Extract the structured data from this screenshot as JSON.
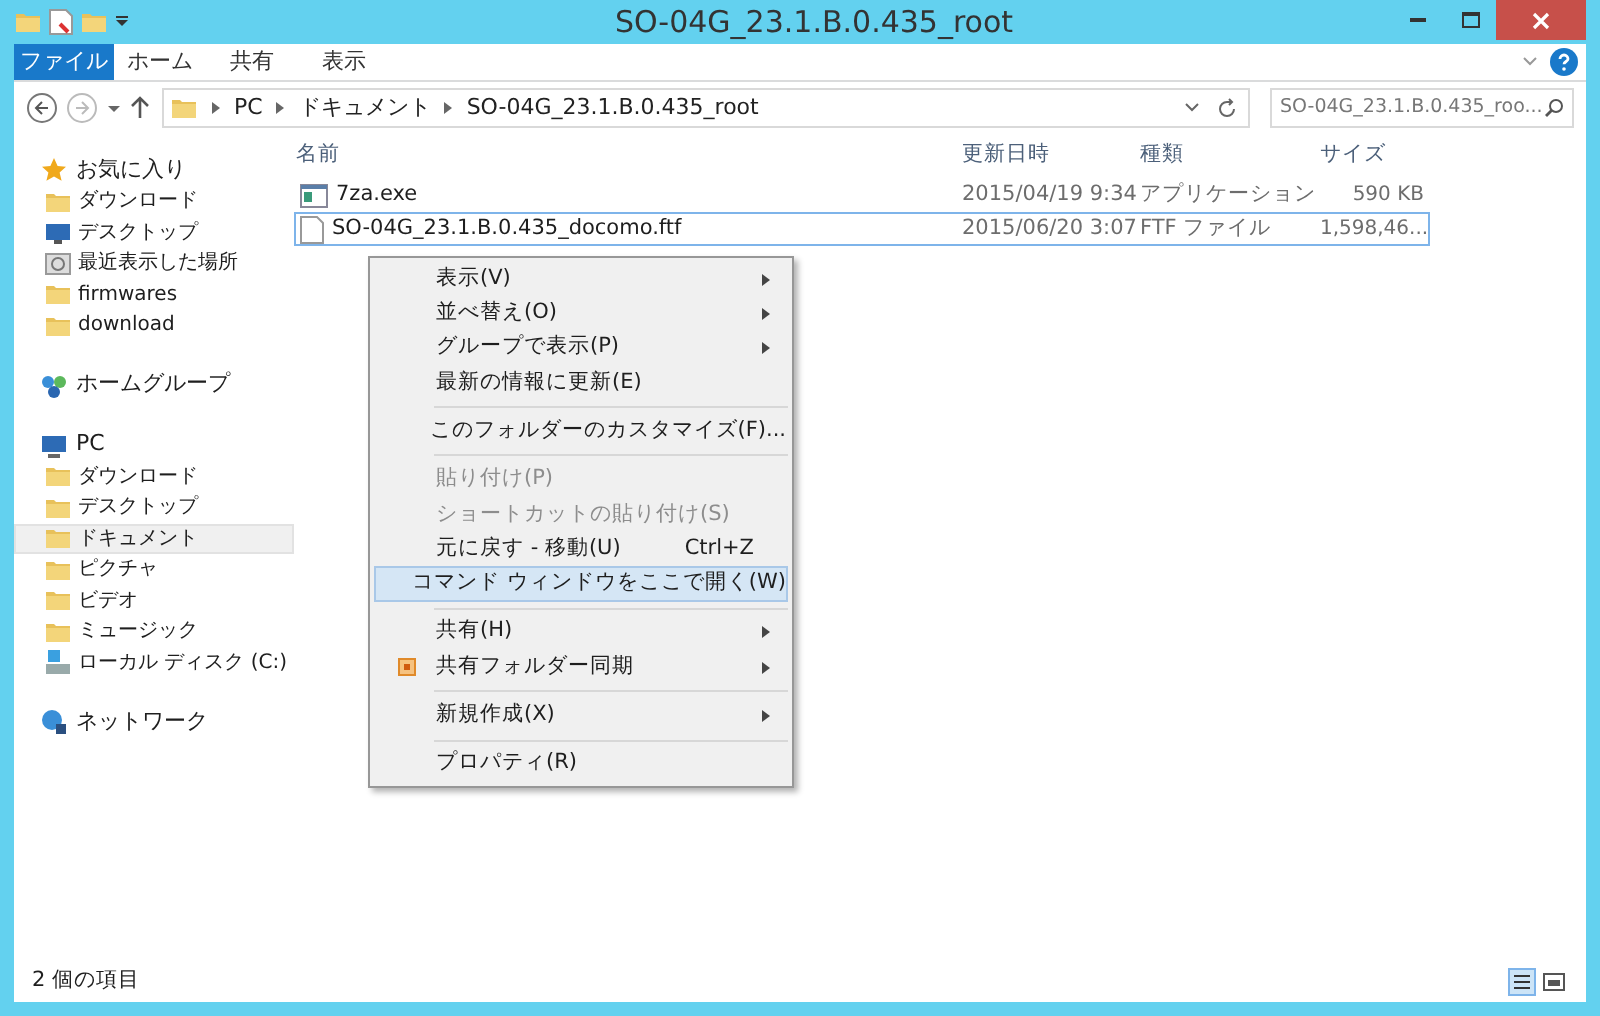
{
  "window": {
    "title": "SO-04G_23.1.B.0.435_root"
  },
  "ribbon_tabs": [
    {
      "label": "ファイル",
      "selected": true
    },
    {
      "label": "ホーム",
      "selected": false
    },
    {
      "label": "共有",
      "selected": false
    },
    {
      "label": "表示",
      "selected": false
    }
  ],
  "address_bar": {
    "crumbs": [
      "PC",
      "ドキュメント",
      "SO-04G_23.1.B.0.435_root"
    ]
  },
  "search": {
    "placeholder": "SO-04G_23.1.B.0.435_roo..."
  },
  "sidebar": {
    "groups": [
      {
        "label": "お気に入り",
        "kind": "star",
        "children": [
          {
            "label": "ダウンロード",
            "kind": "folder",
            "selected": false
          },
          {
            "label": "デスクトップ",
            "kind": "desktop",
            "selected": false
          },
          {
            "label": "最近表示した場所",
            "kind": "recent",
            "selected": false
          },
          {
            "label": "firmwares",
            "kind": "folder",
            "selected": false
          },
          {
            "label": "download",
            "kind": "folder",
            "selected": false
          }
        ]
      },
      {
        "label": "ホームグループ",
        "kind": "homegroup"
      },
      {
        "label": "PC",
        "kind": "pc",
        "children": [
          {
            "label": "ダウンロード",
            "kind": "folder",
            "selected": false
          },
          {
            "label": "デスクトップ",
            "kind": "folder",
            "selected": false
          },
          {
            "label": "ドキュメント",
            "kind": "folder",
            "selected": true
          },
          {
            "label": "ピクチャ",
            "kind": "folder",
            "selected": false
          },
          {
            "label": "ビデオ",
            "kind": "folder",
            "selected": false
          },
          {
            "label": "ミュージック",
            "kind": "folder",
            "selected": false
          },
          {
            "label": "ローカル ディスク (C:)",
            "kind": "drive",
            "selected": false
          }
        ]
      },
      {
        "label": "ネットワーク",
        "kind": "network"
      }
    ]
  },
  "table": {
    "columns": [
      "名前",
      "更新日時",
      "種類",
      "サイズ"
    ],
    "rows": [
      {
        "kind": "exe",
        "name": "7za.exe",
        "date": "2015/04/19 9:34",
        "type": "アプリケーション",
        "size": "590 KB",
        "selected": false
      },
      {
        "kind": "file",
        "name": "SO-04G_23.1.B.0.435_docomo.ftf",
        "date": "2015/06/20 3:07",
        "type": "FTF ファイル",
        "size": "1,598,46...",
        "selected": true
      }
    ]
  },
  "context_menu": [
    {
      "kind": "item",
      "label": "表示(V)",
      "submenu": true,
      "disabled": false,
      "selected": false
    },
    {
      "kind": "item",
      "label": "並べ替え(O)",
      "submenu": true,
      "disabled": false,
      "selected": false
    },
    {
      "kind": "item",
      "label": "グループで表示(P)",
      "submenu": true,
      "disabled": false,
      "selected": false
    },
    {
      "kind": "item",
      "label": "最新の情報に更新(E)",
      "submenu": false,
      "disabled": false,
      "selected": false
    },
    {
      "kind": "separator"
    },
    {
      "kind": "item",
      "label": "このフォルダーのカスタマイズ(F)...",
      "submenu": false,
      "disabled": false,
      "selected": false
    },
    {
      "kind": "separator"
    },
    {
      "kind": "item",
      "label": "貼り付け(P)",
      "submenu": false,
      "disabled": true,
      "selected": false
    },
    {
      "kind": "item",
      "label": "ショートカットの貼り付け(S)",
      "submenu": false,
      "disabled": true,
      "selected": false
    },
    {
      "kind": "item",
      "label": "元に戻す - 移動(U)",
      "shortcut": "Ctrl+Z",
      "submenu": false,
      "disabled": false,
      "selected": false
    },
    {
      "kind": "item",
      "label": "コマンド ウィンドウをここで開く(W)",
      "submenu": false,
      "disabled": false,
      "selected": true
    },
    {
      "kind": "separator"
    },
    {
      "kind": "item",
      "label": "共有(H)",
      "submenu": true,
      "disabled": false,
      "selected": false
    },
    {
      "kind": "item",
      "label": "共有フォルダー同期",
      "icon": true,
      "submenu": true,
      "disabled": false,
      "selected": false
    },
    {
      "kind": "separator"
    },
    {
      "kind": "item",
      "label": "新規作成(X)",
      "submenu": true,
      "disabled": false,
      "selected": false
    },
    {
      "kind": "separator"
    },
    {
      "kind": "item",
      "label": "プロパティ(R)",
      "submenu": false,
      "disabled": false,
      "selected": false
    }
  ],
  "status_bar": {
    "text": "2 個の項目"
  }
}
